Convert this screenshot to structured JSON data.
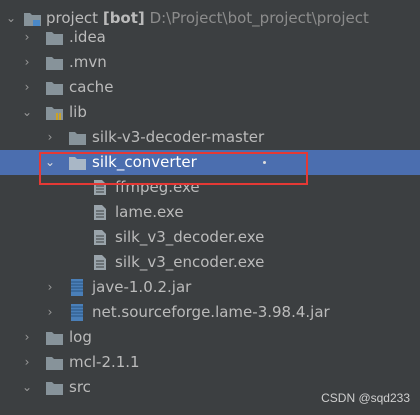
{
  "colors": {
    "background": "#3c3f41",
    "selection": "#4b6eaf",
    "highlight_border": "#e53935",
    "folder": "#87939a",
    "text": "#bbbbbb"
  },
  "tree": {
    "root": {
      "name": "project",
      "module": "[bot]",
      "path": "D:\\Project\\bot_project\\project"
    },
    "items": [
      {
        "label": ".idea",
        "icon": "folder-icon"
      },
      {
        "label": ".mvn",
        "icon": "folder-icon"
      },
      {
        "label": "cache",
        "icon": "folder-icon"
      },
      {
        "label": "lib",
        "icon": "library-folder-icon"
      },
      {
        "label": "silk-v3-decoder-master",
        "icon": "folder-icon"
      },
      {
        "label": "silk_converter",
        "icon": "folder-icon",
        "selected": true
      },
      {
        "label": "ffmpeg.exe",
        "icon": "file-icon"
      },
      {
        "label": "lame.exe",
        "icon": "file-icon"
      },
      {
        "label": "silk_v3_decoder.exe",
        "icon": "file-icon"
      },
      {
        "label": "silk_v3_encoder.exe",
        "icon": "file-icon"
      },
      {
        "label": "jave-1.0.2.jar",
        "icon": "jar-icon"
      },
      {
        "label": "net.sourceforge.lame-3.98.4.jar",
        "icon": "jar-icon"
      },
      {
        "label": "log",
        "icon": "folder-icon"
      },
      {
        "label": "mcl-2.1.1",
        "icon": "folder-icon"
      },
      {
        "label": "src",
        "icon": "folder-icon"
      }
    ]
  },
  "watermark": "CSDN @sqd233"
}
